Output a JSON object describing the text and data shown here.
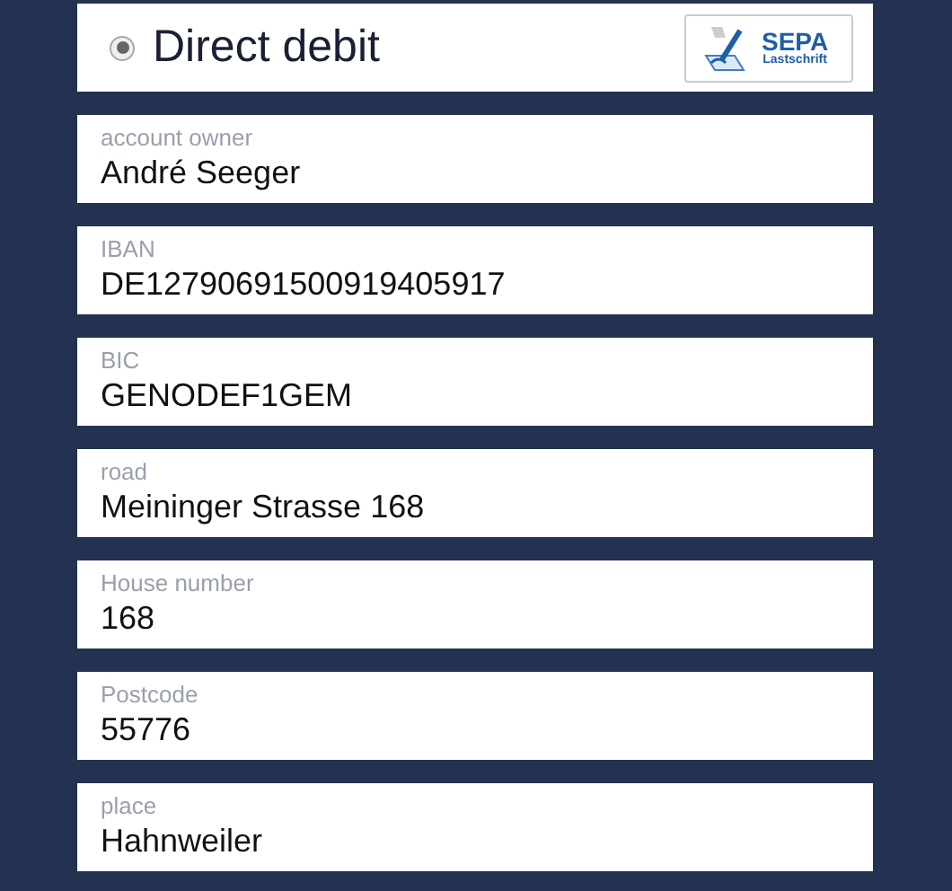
{
  "payment_option": {
    "label": "Direct debit",
    "selected": true,
    "logo": {
      "title": "SEPA",
      "subtitle": "Lastschrift"
    }
  },
  "fields": [
    {
      "label": "account owner",
      "value": "André Seeger"
    },
    {
      "label": "IBAN",
      "value": "DE12790691500919405917"
    },
    {
      "label": "BIC",
      "value": "GENODEF1GEM"
    },
    {
      "label": "road",
      "value": "Meininger Strasse 168"
    },
    {
      "label": "House number",
      "value": "168"
    },
    {
      "label": "Postcode",
      "value": "55776"
    },
    {
      "label": "place",
      "value": "Hahnweiler"
    }
  ]
}
